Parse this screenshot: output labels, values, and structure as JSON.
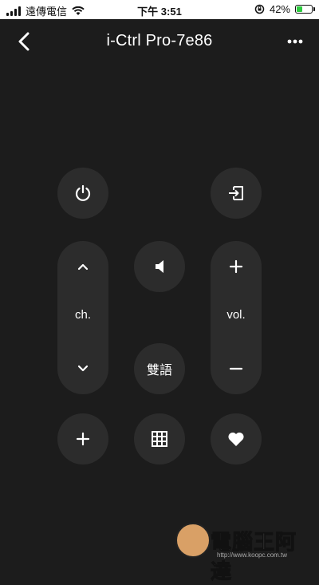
{
  "status_bar": {
    "carrier": "遠傳電信",
    "time": "下午 3:51",
    "battery_percent": "42%",
    "battery_level": 0.42,
    "icons": [
      "signal-icon",
      "wifi-icon",
      "orientation-lock-icon",
      "battery-icon"
    ]
  },
  "header": {
    "title": "i-Ctrl Pro-7e86",
    "back_icon": "chevron-left-icon",
    "more_icon": "more-horizontal-icon"
  },
  "remote": {
    "power_icon": "power-icon",
    "input_icon": "input-source-icon",
    "mute_icon": "volume-mute-icon",
    "channel": {
      "label": "ch.",
      "up_icon": "chevron-up-icon",
      "down_icon": "chevron-down-icon"
    },
    "volume": {
      "label": "vol.",
      "up_icon": "plus-icon",
      "down_icon": "minus-icon"
    },
    "bilingual_label": "雙語",
    "add_icon": "plus-icon",
    "keypad_icon": "grid-icon",
    "favorite_icon": "heart-icon"
  },
  "watermark": {
    "text": "電腦王阿達",
    "url": "http://www.koopc.com.tw"
  },
  "colors": {
    "background": "#1c1c1c",
    "button": "#2c2c2c",
    "foreground": "#ffffff",
    "battery": "#2ecc40"
  }
}
